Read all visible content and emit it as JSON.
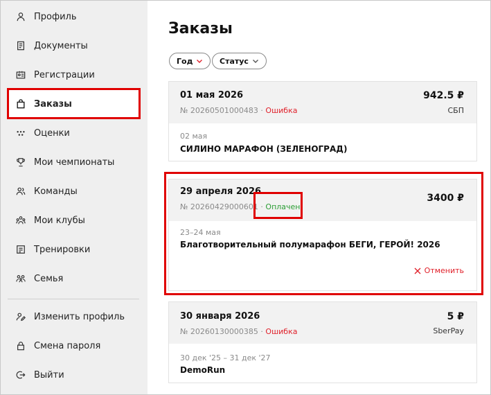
{
  "sidebar": {
    "items": [
      {
        "label": "Профиль",
        "icon": "user-icon"
      },
      {
        "label": "Документы",
        "icon": "document-icon"
      },
      {
        "label": "Регистрации",
        "icon": "id-card-icon"
      },
      {
        "label": "Заказы",
        "icon": "shopping-bag-icon"
      },
      {
        "label": "Оценки",
        "icon": "dots-icon"
      },
      {
        "label": "Мои чемпионаты",
        "icon": "trophy-icon"
      },
      {
        "label": "Команды",
        "icon": "team-icon"
      },
      {
        "label": "Мои клубы",
        "icon": "clubs-icon"
      },
      {
        "label": "Тренировки",
        "icon": "training-icon"
      },
      {
        "label": "Семья",
        "icon": "family-icon"
      }
    ],
    "bottom_items": [
      {
        "label": "Изменить профиль",
        "icon": "edit-profile-icon"
      },
      {
        "label": "Смена пароля",
        "icon": "lock-icon"
      },
      {
        "label": "Выйти",
        "icon": "logout-icon"
      }
    ],
    "active_index": 3
  },
  "main": {
    "title": "Заказы",
    "filters": [
      {
        "label": "Год"
      },
      {
        "label": "Статус"
      }
    ],
    "orders": [
      {
        "date": "01 мая 2026",
        "number": "№ 20260501000483",
        "separator": "·",
        "status": "Ошибка",
        "amount": "942.5 ₽",
        "method": "СБП",
        "event_date": "02 мая",
        "event_name": "СИЛИНО МАРАФОН (ЗЕЛЕНОГРАД)"
      },
      {
        "date": "29 апреля 2026",
        "number": "№ 20260429000601",
        "separator": "·",
        "status": "Оплачен",
        "amount": "3400 ₽",
        "method": "",
        "event_date": "23–24 мая",
        "event_name": "Благотворительный полумарафон БЕГИ, ГЕРОЙ! 2026",
        "cancel_label": "Отменить"
      },
      {
        "date": "30 января 2026",
        "number": "№ 20260130000385",
        "separator": "·",
        "status": "Ошибка",
        "amount": "5 ₽",
        "method": "SberPay",
        "event_date": "30 дек '25 – 31 дек '27",
        "event_name": "DemoRun"
      }
    ]
  },
  "colors": {
    "accent_red": "#e00000",
    "error": "#e0202a",
    "success": "#2a9d34",
    "sidebar_bg": "#efefef",
    "card_head_bg": "#f2f2f2"
  }
}
